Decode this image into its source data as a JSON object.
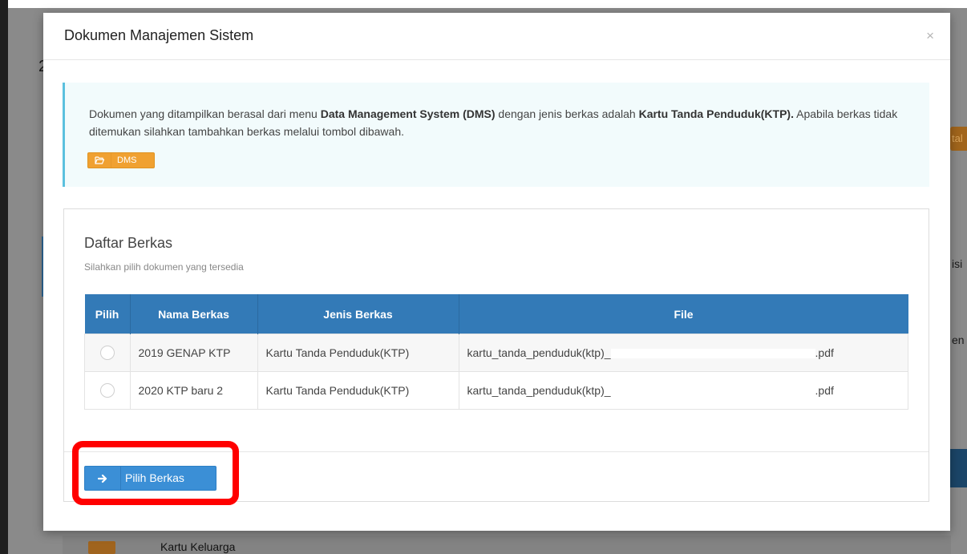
{
  "background": {
    "right_text_1": "tal",
    "right_text_2": "isi",
    "right_text_3": "en",
    "left_text": "2",
    "bottom_row_label": "Kartu Keluarga"
  },
  "modal": {
    "title": "Dokumen Manajemen Sistem",
    "close": "×",
    "info": {
      "text_1": "Dokumen yang ditampilkan berasal dari menu ",
      "bold_1": "Data Management System (DMS)",
      "text_2": " dengan jenis berkas adalah ",
      "bold_2": "Kartu Tanda Penduduk(KTP).",
      "text_3": " Apabila berkas tidak ditemukan silahkan tambahkan berkas melalui tombol dibawah.",
      "dms_button": "DMS",
      "dms_icon": "folder-open-icon"
    },
    "panel": {
      "title": "Daftar Berkas",
      "subtitle": "Silahkan pilih dokumen yang tersedia",
      "table": {
        "headers": [
          "Pilih",
          "Nama Berkas",
          "Jenis Berkas",
          "File"
        ],
        "rows": [
          {
            "nama": "2019 GENAP KTP",
            "jenis": "Kartu Tanda Penduduk(KTP)",
            "file_prefix": "kartu_tanda_penduduk(ktp)_",
            "file_suffix": ".pdf"
          },
          {
            "nama": "2020 KTP baru 2",
            "jenis": "Kartu Tanda Penduduk(KTP)",
            "file_prefix": "kartu_tanda_penduduk(ktp)_",
            "file_suffix": ".pdf"
          }
        ]
      },
      "submit_button": "Pilih Berkas",
      "submit_icon": "arrow-right-icon"
    }
  },
  "colors": {
    "primary": "#337ab7",
    "button_blue": "#3b8fd6",
    "warning": "#f0a131",
    "info_border": "#5bc0de",
    "highlight": "#ff0000"
  }
}
